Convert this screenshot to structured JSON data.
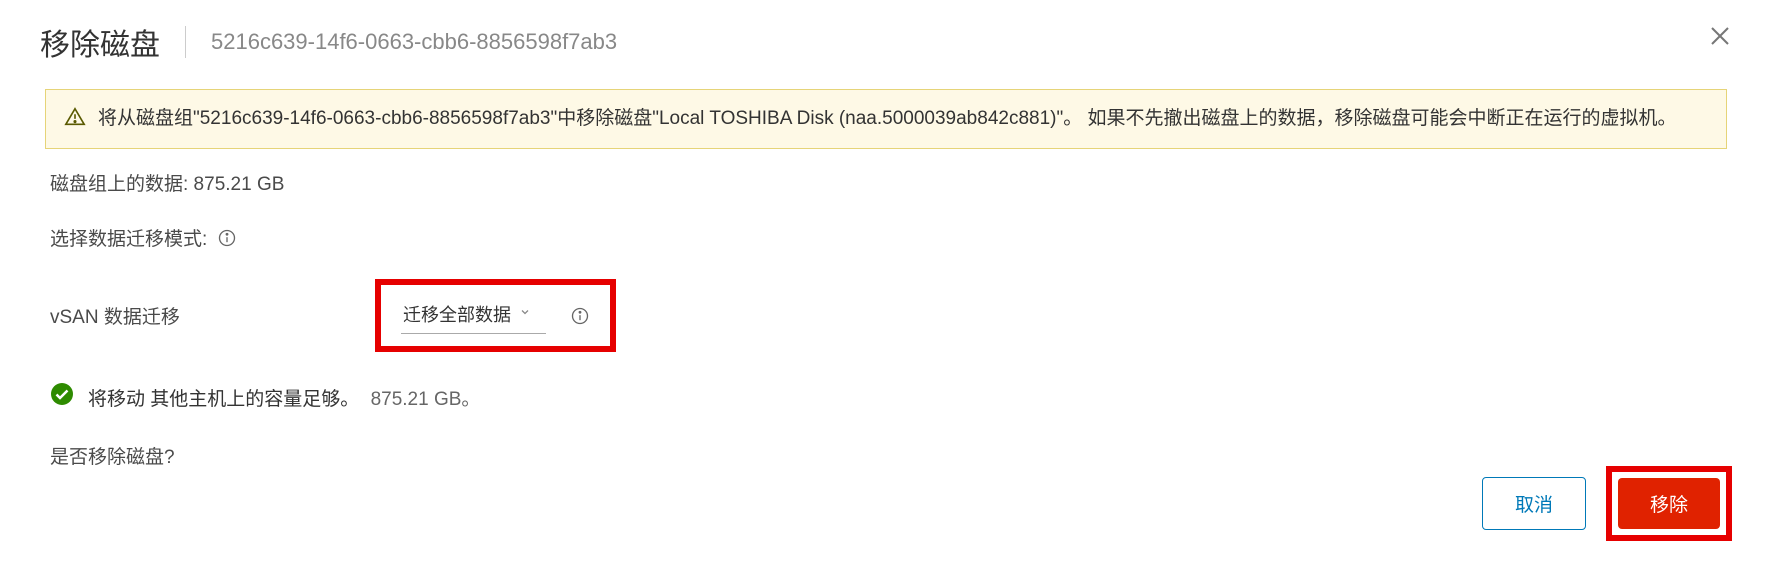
{
  "header": {
    "title": "移除磁盘",
    "subtitle": "5216c639-14f6-0663-cbb6-8856598f7ab3"
  },
  "warning": {
    "text": "将从磁盘组\"5216c639-14f6-0663-cbb6-8856598f7ab3\"中移除磁盘\"Local TOSHIBA Disk (naa.5000039ab842c881)\"。 如果不先撤出磁盘上的数据，移除磁盘可能会中断正在运行的虚拟机。"
  },
  "diskGroupData": {
    "label": "磁盘组上的数据: 875.21 GB"
  },
  "migrationMode": {
    "label": "选择数据迁移模式:"
  },
  "vsanMigration": {
    "label": "vSAN 数据迁移",
    "selected": "迁移全部数据"
  },
  "status": {
    "text": "将移动 其他主机上的容量足够。",
    "value": "875.21 GB。"
  },
  "confirm": {
    "text": "是否移除磁盘?"
  },
  "buttons": {
    "cancel": "取消",
    "remove": "移除"
  }
}
